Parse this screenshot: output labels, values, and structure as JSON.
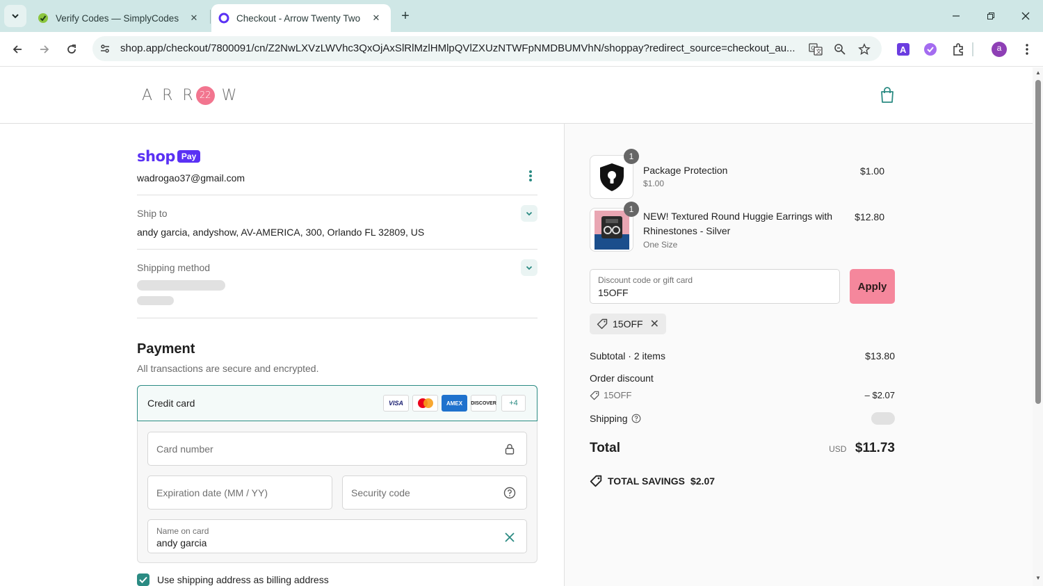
{
  "browser": {
    "tabs": [
      {
        "title": "Verify Codes — SimplyCodes",
        "active": false
      },
      {
        "title": "Checkout - Arrow Twenty Two",
        "active": true
      }
    ],
    "url": "shop.app/checkout/7800091/cn/Z2NwLXVzLWVhc3QxOjAxSlRlMzlHMlpQVlZXUzNTWFpNMDBUMVhN/shoppay?redirect_source=checkout_au...",
    "profile_initial": "a"
  },
  "store": {
    "logo_letters": [
      "A",
      "R",
      "R",
      "22",
      "W"
    ]
  },
  "account": {
    "shop_label": "shop",
    "pay_label": "Pay",
    "email": "wadrogao37@gmail.com"
  },
  "shipping": {
    "ship_to_label": "Ship to",
    "ship_to_value": "andy garcia, andyshow, AV-AMERICA, 300, Orlando FL 32809, US",
    "method_label": "Shipping method"
  },
  "payment": {
    "title": "Payment",
    "subtitle": "All transactions are secure and encrypted.",
    "method": "Credit card",
    "cards": [
      "VISA",
      "MC",
      "AMEX",
      "DISCOVER"
    ],
    "more_cards": "+4",
    "card_number_placeholder": "Card number",
    "expiry_placeholder": "Expiration date (MM / YY)",
    "security_placeholder": "Security code",
    "name_label": "Name on card",
    "name_value": "andy garcia",
    "billing_label": "Use shipping address as billing address"
  },
  "order": {
    "items": [
      {
        "name": "Package Protection",
        "name2": "",
        "variant": "$1.00",
        "price": "$1.00",
        "qty": "1"
      },
      {
        "name": "NEW! Textured Round Huggie Earrings with",
        "name2": "Rhinestones - Silver",
        "variant": "One Size",
        "price": "$12.80",
        "qty": "1"
      }
    ],
    "discount_label": "Discount code or gift card",
    "discount_value": "15OFF",
    "apply_label": "Apply",
    "applied_code": "15OFF",
    "subtotal_label": "Subtotal · 2 items",
    "subtotal_value": "$13.80",
    "order_discount_label": "Order discount",
    "order_discount_code": "15OFF",
    "order_discount_value": "– $2.07",
    "shipping_label": "Shipping",
    "total_label": "Total",
    "currency": "USD",
    "total_value": "$11.73",
    "savings_label": "TOTAL SAVINGS",
    "savings_value": "$2.07"
  },
  "colors": {
    "accent": "#2b8b83",
    "shop_purple": "#5a31f4",
    "apply_pink": "#f5879c",
    "tabstrip": "#cfe7e6"
  }
}
